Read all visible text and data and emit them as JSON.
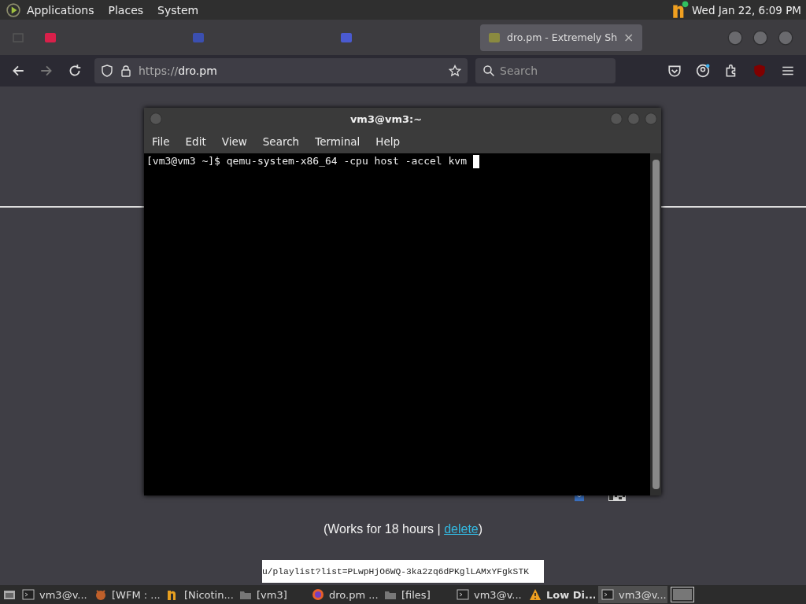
{
  "top_panel": {
    "menus": [
      "Applications",
      "Places",
      "System"
    ],
    "clock": "Wed Jan 22,  6:09 PM"
  },
  "browser": {
    "tabs": [
      {
        "kind": "faded",
        "selected": false,
        "color": "#d8204a"
      },
      {
        "kind": "faded",
        "selected": false,
        "color": "#3b4fb0"
      },
      {
        "kind": "faded",
        "selected": false,
        "color": "#4a5ad0"
      },
      {
        "kind": "normal",
        "title": "dro.pm - Extremely Sh",
        "selected": true,
        "color": "#8a8a40"
      }
    ],
    "close_glyph": "×",
    "url_scheme": "https://",
    "url_host": "dro.pm",
    "search_placeholder": "Search"
  },
  "page": {
    "note_before": "(Works for 18 hours | ",
    "link": "delete",
    "note_after": ")",
    "share_url": "u/playlist?list=PLwpHjO6WQ-3ka2zq6dPKglLAMxYFgkSTK"
  },
  "terminal": {
    "title": "vm3@vm3:~",
    "menu": [
      "File",
      "Edit",
      "View",
      "Search",
      "Terminal",
      "Help"
    ],
    "line": "[vm3@vm3 ~]$ qemu-system-x86_64 -cpu host -accel kvm "
  },
  "taskbar": [
    {
      "kind": "terminal",
      "label": "vm3@v...",
      "selected": false,
      "bold": false
    },
    {
      "kind": "app",
      "label": "[WFM : ...",
      "selected": false,
      "bold": false
    },
    {
      "kind": "nicotine",
      "label": "[Nicotin...",
      "selected": false,
      "bold": false
    },
    {
      "kind": "folder",
      "label": "[vm3]",
      "selected": false,
      "bold": false
    },
    {
      "kind": "browser",
      "label": "dro.pm ...",
      "selected": false,
      "bold": false
    },
    {
      "kind": "folder",
      "label": "[files]",
      "selected": false,
      "bold": false
    },
    {
      "kind": "terminal",
      "label": "vm3@v...",
      "selected": false,
      "bold": false
    },
    {
      "kind": "warning",
      "label": "Low Di...",
      "selected": false,
      "bold": true
    },
    {
      "kind": "terminal",
      "label": "vm3@v...",
      "selected": true,
      "bold": false
    }
  ]
}
